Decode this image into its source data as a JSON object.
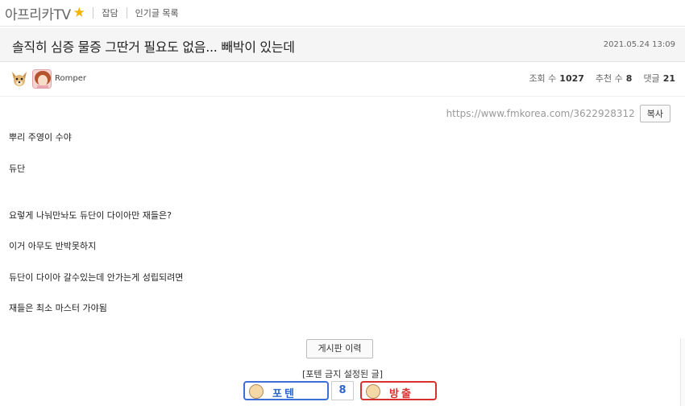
{
  "nav": {
    "board_name": "아프리카TV",
    "links": [
      "잡담",
      "인기글 목록"
    ]
  },
  "post": {
    "title": "솔직히 심증 물증 그딴거 필요도 없음... 빼박이 있는데",
    "date": "2021.05.24 13:09",
    "author": "Romper",
    "stats": {
      "views_label": "조회 수",
      "views": "1027",
      "recommend_label": "추천 수",
      "recommend": "8",
      "comments_label": "댓글",
      "comments": "21"
    },
    "url": "https://www.fmkorea.com/3622928312",
    "copy_label": "복사",
    "body_lines": [
      "뿌리 주영이 수야",
      "듀단",
      "요렇게 나눠만놔도 듀단이 다이아만 재들은?",
      "이거 아무도 반박못하지",
      "듀단이 다이아 갈수있는데 안가는게 성립되려면",
      "재들은 최소 마스터 가야됨"
    ]
  },
  "footer": {
    "history_label": "게시판 이력",
    "ban_note": "[포텐 금지 설정된 글]",
    "vote_up_label": "포텐",
    "vote_count": "8",
    "vote_down_label": "방출"
  },
  "colors": {
    "vote_up": "#3c6fd8",
    "vote_down": "#d9312f",
    "star": "#f4b400"
  }
}
